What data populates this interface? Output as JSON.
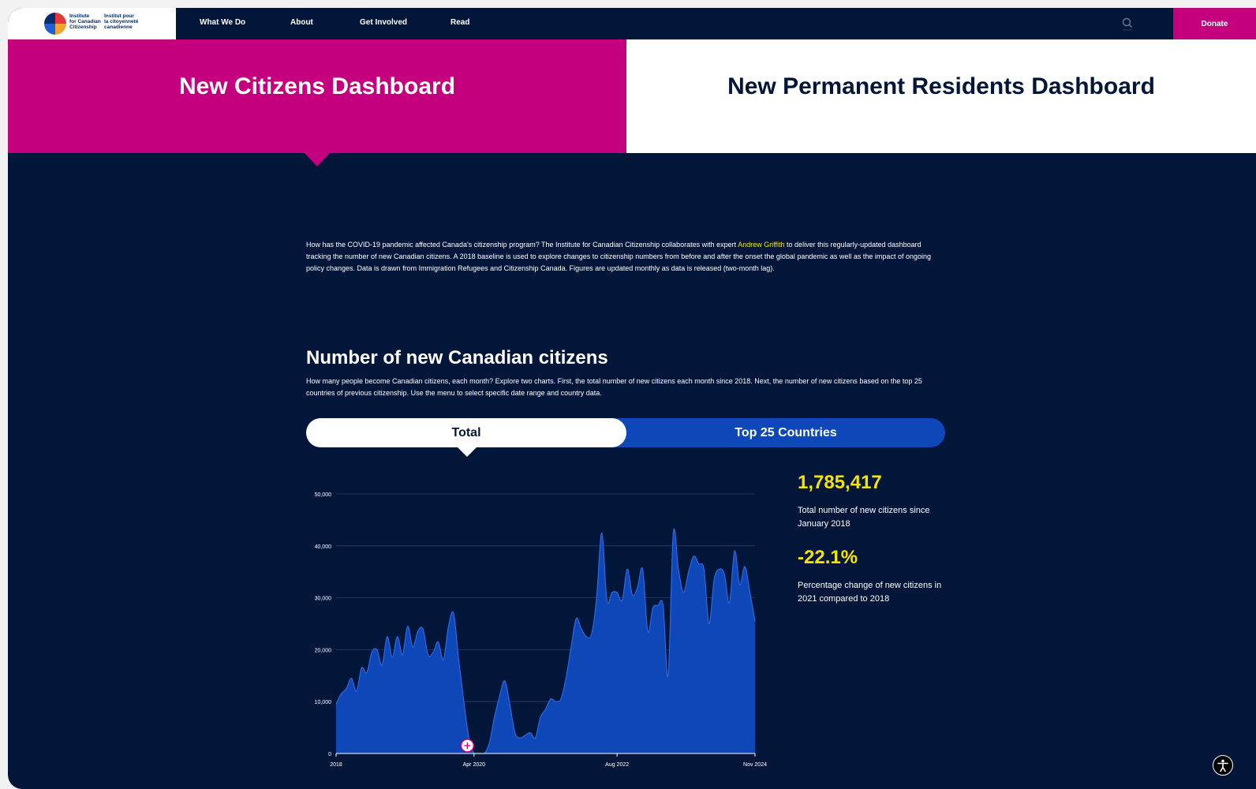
{
  "header": {
    "logo_en": "Institute\nfor Canadian\nCitizenship",
    "logo_fr": "Institut pour\nla citoyenneté\ncanadienne",
    "nav": [
      "What We Do",
      "About",
      "Get Involved",
      "Read"
    ],
    "donate_label": "Donate"
  },
  "dashboards": {
    "citizens": "New Citizens Dashboard",
    "residents": "New Permanent Residents Dashboard"
  },
  "intro": {
    "before": "How has the COVID-19 pandemic affected Canada's citizenship program? The Institute for Canadian Citizenship collaborates with expert ",
    "link": "Andrew Griffith",
    "after": " to deliver this regularly-updated dashboard tracking the number of new Canadian citizens. A 2018 baseline is used to explore changes to citizenship numbers from before and after the onset the global pandemic as well as the impact of ongoing policy changes. Data is drawn from Immigration Refugees and Citizenship Canada. Figures are updated monthly as data is released (two-month lag)."
  },
  "section": {
    "title": "Number of new Canadian citizens",
    "description": "How many people become Canadian citizens, each month? Explore two charts. First, the total number of new citizens each month since 2018. Next, the number of new citizens based on the top 25 countries of previous citizenship. Use the menu to select specific date range and country data."
  },
  "tabs": {
    "total": "Total",
    "top25": "Top 25 Countries"
  },
  "stats": [
    {
      "value": "1,785,417",
      "label": "Total number of new citizens since January 2018"
    },
    {
      "value": "-22.1%",
      "label": "Percentage change of new citizens in 2021 compared to 2018"
    }
  ],
  "colors": {
    "navy": "#02163a",
    "magenta": "#c4007f",
    "blue": "#0d47b8",
    "yellow": "#f4e400"
  },
  "chart_data": {
    "type": "area",
    "title": "",
    "xlabel": "",
    "ylabel": "",
    "ylim": [
      0,
      50000
    ],
    "yticks": [
      0,
      10000,
      20000,
      30000,
      40000,
      50000
    ],
    "ytick_labels": [
      "0",
      "10,000",
      "20,000",
      "30,000",
      "40,000",
      "50,000"
    ],
    "xlim": [
      "2018-01",
      "2024-11"
    ],
    "xtick_labels": [
      {
        "date": "2018-01",
        "label": "2018"
      },
      {
        "date": "2020-04",
        "label": "Apr 2020"
      },
      {
        "date": "2022-08",
        "label": "Aug 2022"
      },
      {
        "date": "2024-11",
        "label": "Nov 2024"
      }
    ],
    "grid": true,
    "series": [
      {
        "values": [
          [
            "2018-01",
            9500
          ],
          [
            "2018-02",
            11500
          ],
          [
            "2018-03",
            12500
          ],
          [
            "2018-04",
            14500
          ],
          [
            "2018-05",
            12000
          ],
          [
            "2018-06",
            16500
          ],
          [
            "2018-07",
            15500
          ],
          [
            "2018-08",
            19500
          ],
          [
            "2018-09",
            20000
          ],
          [
            "2018-10",
            17000
          ],
          [
            "2018-11",
            22500
          ],
          [
            "2018-12",
            18500
          ],
          [
            "2019-01",
            22500
          ],
          [
            "2019-02",
            19000
          ],
          [
            "2019-03",
            24500
          ],
          [
            "2019-04",
            20500
          ],
          [
            "2019-05",
            23500
          ],
          [
            "2019-06",
            24000
          ],
          [
            "2019-07",
            19000
          ],
          [
            "2019-08",
            19500
          ],
          [
            "2019-09",
            21500
          ],
          [
            "2019-10",
            18000
          ],
          [
            "2019-11",
            24500
          ],
          [
            "2019-12",
            27000
          ],
          [
            "2020-01",
            18000
          ],
          [
            "2020-02",
            10000
          ],
          [
            "2020-03",
            3000
          ],
          [
            "2020-04",
            0
          ],
          [
            "2020-05",
            0
          ],
          [
            "2020-06",
            0
          ],
          [
            "2020-07",
            2000
          ],
          [
            "2020-08",
            7000
          ],
          [
            "2020-09",
            11000
          ],
          [
            "2020-10",
            14000
          ],
          [
            "2020-11",
            9500
          ],
          [
            "2020-12",
            4000
          ],
          [
            "2021-01",
            3000
          ],
          [
            "2021-02",
            3500
          ],
          [
            "2021-03",
            4000
          ],
          [
            "2021-04",
            3000
          ],
          [
            "2021-05",
            7000
          ],
          [
            "2021-06",
            8500
          ],
          [
            "2021-07",
            10500
          ],
          [
            "2021-08",
            10000
          ],
          [
            "2021-09",
            10500
          ],
          [
            "2021-10",
            14500
          ],
          [
            "2021-11",
            20500
          ],
          [
            "2021-12",
            26000
          ],
          [
            "2022-01",
            24000
          ],
          [
            "2022-02",
            22500
          ],
          [
            "2022-03",
            23000
          ],
          [
            "2022-04",
            30000
          ],
          [
            "2022-05",
            42500
          ],
          [
            "2022-06",
            29500
          ],
          [
            "2022-07",
            31000
          ],
          [
            "2022-08",
            31000
          ],
          [
            "2022-09",
            29500
          ],
          [
            "2022-10",
            35500
          ],
          [
            "2022-11",
            30500
          ],
          [
            "2022-12",
            32000
          ],
          [
            "2023-01",
            35500
          ],
          [
            "2023-02",
            23500
          ],
          [
            "2023-03",
            28000
          ],
          [
            "2023-04",
            28500
          ],
          [
            "2023-05",
            28500
          ],
          [
            "2023-06",
            15000
          ],
          [
            "2023-07",
            42500
          ],
          [
            "2023-08",
            35500
          ],
          [
            "2023-09",
            31000
          ],
          [
            "2023-10",
            35000
          ],
          [
            "2023-11",
            38000
          ],
          [
            "2023-12",
            36500
          ],
          [
            "2024-01",
            35500
          ],
          [
            "2024-02",
            25000
          ],
          [
            "2024-03",
            33500
          ],
          [
            "2024-04",
            35500
          ],
          [
            "2024-05",
            34500
          ],
          [
            "2024-06",
            29000
          ],
          [
            "2024-07",
            39000
          ],
          [
            "2024-08",
            32500
          ],
          [
            "2024-09",
            36000
          ],
          [
            "2024-10",
            31000
          ],
          [
            "2024-11",
            25500
          ]
        ]
      }
    ]
  }
}
